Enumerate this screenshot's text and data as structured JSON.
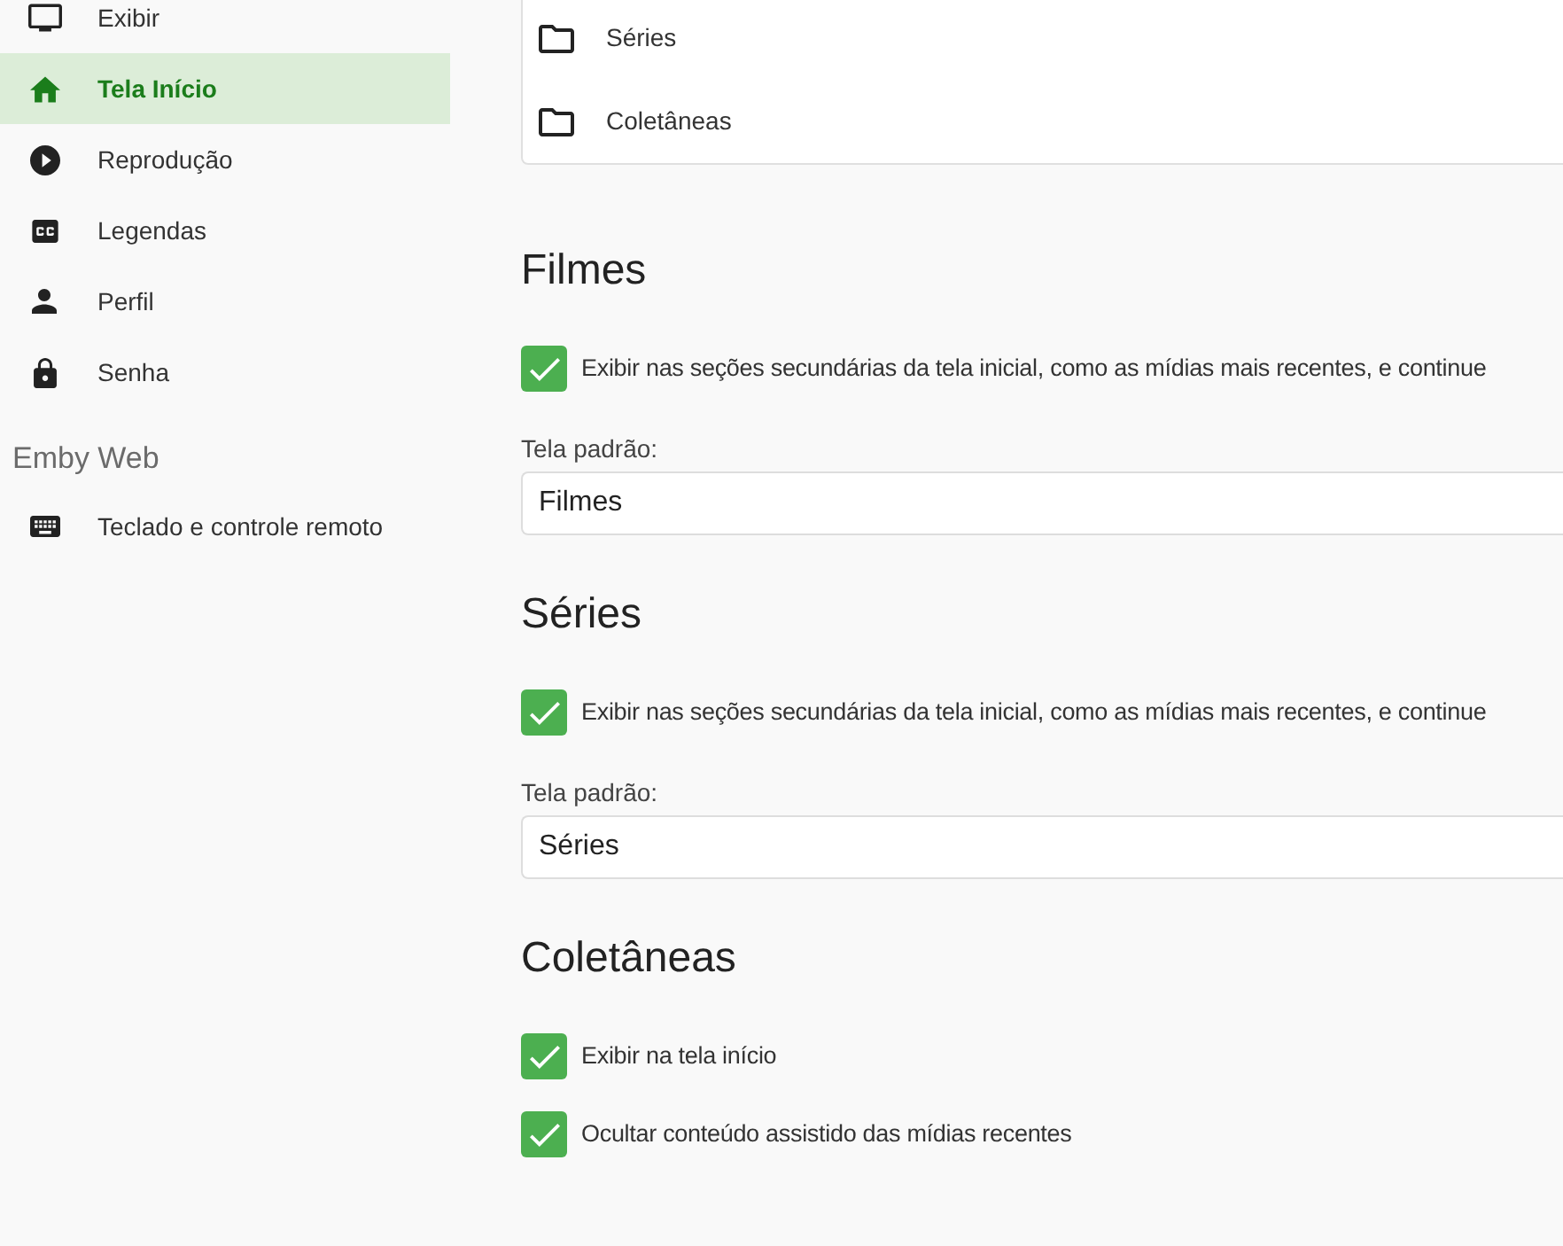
{
  "sidebar": {
    "groups": [
      {
        "items": [
          {
            "label": "Exibir",
            "selected": false
          },
          {
            "label": "Tela Início",
            "selected": true
          },
          {
            "label": "Reprodução",
            "selected": false
          },
          {
            "label": "Legendas",
            "selected": false
          },
          {
            "label": "Perfil",
            "selected": false
          },
          {
            "label": "Senha",
            "selected": false
          }
        ]
      },
      {
        "title": "Emby Web",
        "items": [
          {
            "label": "Teclado e controle remoto",
            "selected": false
          }
        ]
      }
    ]
  },
  "libraries": {
    "items": [
      {
        "label": "Séries"
      },
      {
        "label": "Coletâneas"
      }
    ]
  },
  "sections": [
    {
      "title": "Filmes",
      "options": [
        {
          "label": "Exibir nas seções secundárias da tela inicial, como as mídias mais recentes, e continue",
          "checked": true
        }
      ],
      "default_screen": {
        "label": "Tela padrão:",
        "value": "Filmes"
      }
    },
    {
      "title": "Séries",
      "options": [
        {
          "label": "Exibir nas seções secundárias da tela inicial, como as mídias mais recentes, e continue",
          "checked": true
        }
      ],
      "default_screen": {
        "label": "Tela padrão:",
        "value": "Séries"
      }
    },
    {
      "title": "Coletâneas",
      "options": [
        {
          "label": "Exibir na tela início",
          "checked": true
        },
        {
          "label": "Ocultar conteúdo assistido das mídias recentes",
          "checked": true
        }
      ]
    }
  ]
}
